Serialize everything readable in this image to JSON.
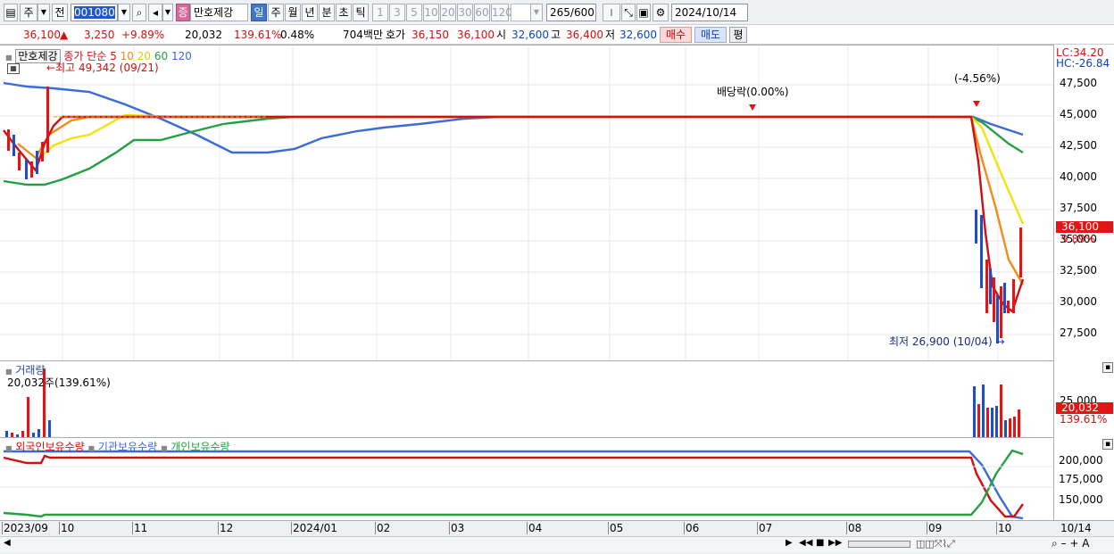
{
  "toolbar": {
    "period_labels": [
      "주",
      "전"
    ],
    "code": "001080",
    "name": "만호제강",
    "stock_badge": "증",
    "interval_buttons": [
      "일",
      "주",
      "월",
      "년",
      "분",
      "초",
      "틱"
    ],
    "minute_buttons": [
      "1",
      "3",
      "5",
      "10",
      "20",
      "30",
      "60",
      "120"
    ],
    "count": "265",
    "count_max": "/600",
    "date": "2024/10/14"
  },
  "quote": {
    "price": "36,100",
    "arrow": "▲",
    "change": "3,250",
    "rate": "+9.89%",
    "volume": "20,032",
    "vol_rate": "139.61%",
    "turnover": "0.48%",
    "amount": "704백만",
    "bid_label": "호가",
    "ask": "36,150",
    "bid": "36,100",
    "open_label": "시",
    "open": "32,600",
    "high_label": "고",
    "high": "36,400",
    "low_label": "저",
    "low": "32,600",
    "buy": "매수",
    "sell": "매도",
    "avg": "평"
  },
  "price_panel": {
    "legend_name": "만호제강",
    "legend_ma": "종가 단순",
    "ma_periods": [
      "5",
      "10",
      "20",
      "60",
      "120"
    ],
    "ma_colors": [
      "#d01010",
      "#f08c1a",
      "#f2e20c",
      "#24a042",
      "#3c6ad8"
    ],
    "high_note": "최고 49,342 (09/21)",
    "low_note": "최저 26,900 (10/04)",
    "dividend_note": "배당락(0.00%)",
    "event_note": "(-4.56%)",
    "lc": "LC:34.20",
    "hc": "HC:-26.84",
    "y_ticks": [
      "47,500",
      "45,000",
      "42,500",
      "40,000",
      "37,500",
      "35,000",
      "32,500",
      "30,000",
      "27,500"
    ],
    "current_price": "36,100",
    "current_rate": "9.89%"
  },
  "volume_panel": {
    "title": "거래량",
    "value": "20,032주(139.61%)",
    "y_tick": "25,000",
    "current": "20,032",
    "current_rate": "139.61%"
  },
  "holding_panel": {
    "legend": [
      "외국인보유수량",
      "기관보유수량",
      "개인보유수량"
    ],
    "legend_colors": [
      "#d01010",
      "#3c6ad8",
      "#24a042"
    ],
    "y_ticks": [
      "200,000",
      "175,000",
      "150,000"
    ]
  },
  "x_axis": {
    "labels": [
      "2023/09",
      "10",
      "11",
      "12",
      "2024/01",
      "02",
      "03",
      "04",
      "05",
      "06",
      "07",
      "08",
      "09",
      "10"
    ],
    "right_label": "10/14"
  }
}
